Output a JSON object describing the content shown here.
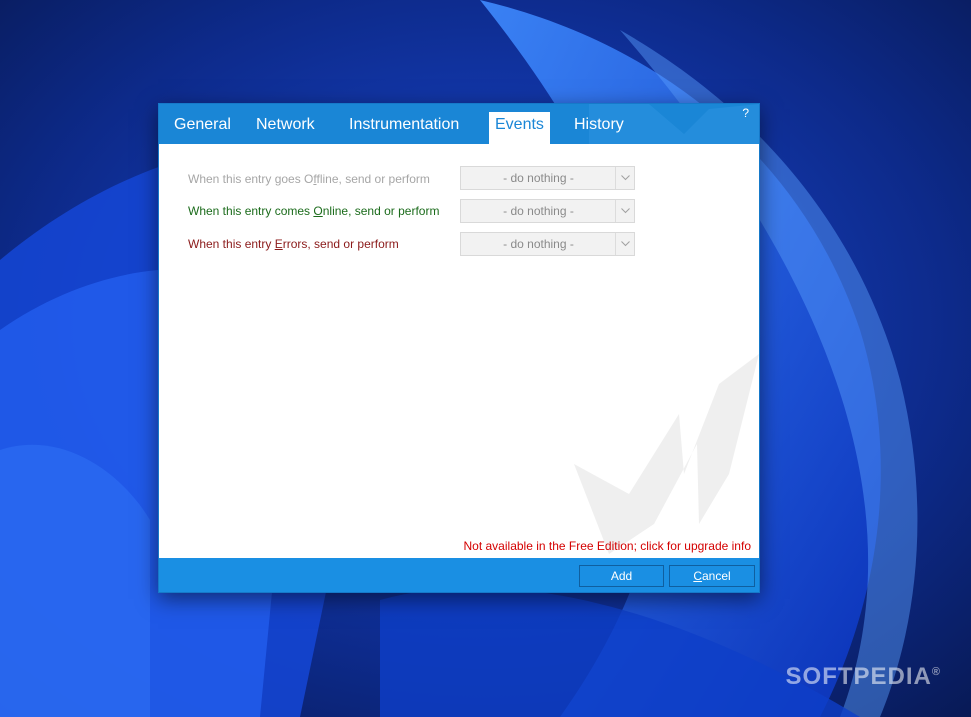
{
  "tabs": [
    {
      "label": "General"
    },
    {
      "label": "Network"
    },
    {
      "label": "Instrumentation"
    },
    {
      "label": "Events",
      "active": true
    },
    {
      "label": "History"
    }
  ],
  "help_label": "?",
  "events": [
    {
      "before": "When this entry goes ",
      "accel": "f",
      "prefix_accel": "O",
      "after": "fline, send or perform",
      "value": "- do nothing -",
      "color": "#a6a6a6"
    },
    {
      "before": "When this entry comes ",
      "accel": "O",
      "after": "nline, send or perform",
      "value": "- do nothing -",
      "color": "#1b6b1b"
    },
    {
      "before": "When this entry ",
      "accel": "E",
      "after": "rrors, send or perform",
      "value": "- do nothing -",
      "color": "#8b1a1a"
    }
  ],
  "notice": "Not available in the Free Edition; click for upgrade info",
  "buttons": {
    "add": "Add",
    "cancel_accel": "C",
    "cancel_rest": "ancel"
  },
  "watermark": "SOFTPEDIA",
  "watermark_reg": "®",
  "colors": {
    "tab_bar": "#1a86d6",
    "footer": "#1a8fe3",
    "notice": "#d40000"
  }
}
